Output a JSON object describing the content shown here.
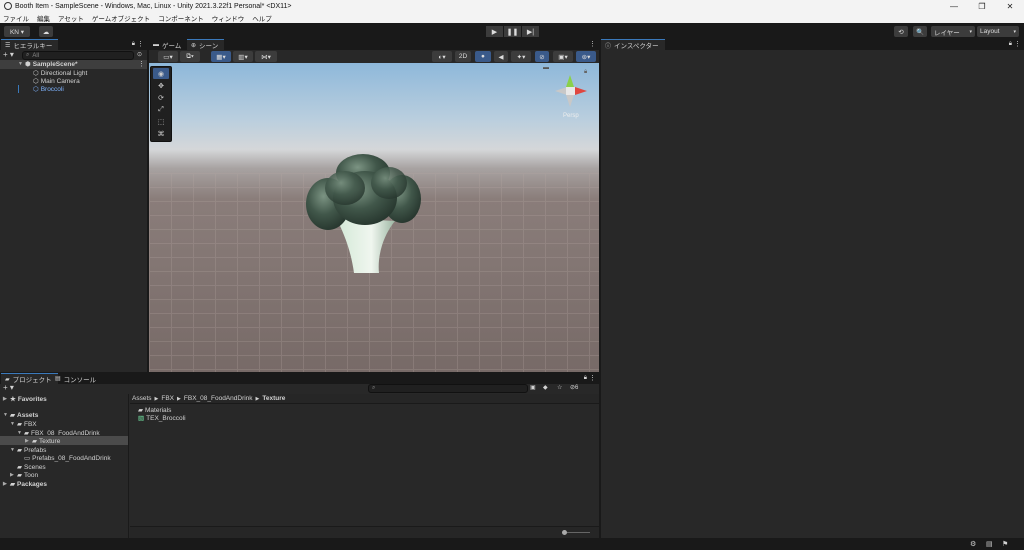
{
  "window": {
    "title": "Booth Item - SampleScene - Windows, Mac, Linux - Unity 2021.3.22f1 Personal* <DX11>",
    "controls": [
      "—",
      "❐",
      "✕"
    ]
  },
  "menu": [
    "ファイル",
    "編集",
    "アセット",
    "ゲームオブジェクト",
    "コンポーネント",
    "ウィンドウ",
    "ヘルプ"
  ],
  "toolbar": {
    "account": "KN ▾",
    "cloud_icon": "☁",
    "play": "▶",
    "pause": "❚❚",
    "step": "▶|",
    "history_icon": "⟲",
    "search_icon": "🔍",
    "layers": "レイヤー",
    "layout": "Layout"
  },
  "hierarchy": {
    "tab": "ヒエラルキー",
    "search_placeholder": "All",
    "add": "+ ▾",
    "items": [
      {
        "label": "SampleScene*"
      },
      {
        "label": "Directional Light"
      },
      {
        "label": "Main Camera"
      },
      {
        "label": "Broccoli"
      }
    ]
  },
  "scene_tabs": {
    "game": "ゲーム",
    "scene": "シーン"
  },
  "scene_toolbar": {
    "mode_2d": "2D",
    "gizmo_label": "Persp"
  },
  "inspector": {
    "tab": "インスペクター"
  },
  "bottom_tabs": {
    "project": "プロジェクト",
    "console": "コンソール"
  },
  "project": {
    "add": "+ ▾",
    "hidden_count": "6",
    "tree": [
      {
        "label": "Favorites"
      },
      {
        "label": "Assets"
      },
      {
        "label": "FBX"
      },
      {
        "label": "FBX_08_FoodAndDrink"
      },
      {
        "label": "Texture"
      },
      {
        "label": "Prefabs"
      },
      {
        "label": "Prefabs_08_FoodAndDrink"
      },
      {
        "label": "Scenes"
      },
      {
        "label": "Toon"
      },
      {
        "label": "Packages"
      }
    ],
    "breadcrumb": [
      "Assets",
      "FBX",
      "FBX_08_FoodAndDrink",
      "Texture"
    ],
    "files": [
      {
        "label": "Materials"
      },
      {
        "label": "TEX_Broccoli"
      }
    ]
  }
}
